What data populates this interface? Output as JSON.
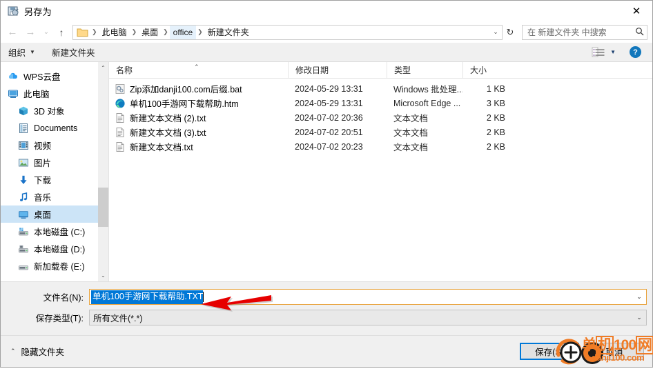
{
  "window": {
    "title": "另存为",
    "title_icon": "save-as-icon",
    "close_label": "✕"
  },
  "address": {
    "back_icon": "←",
    "forward_icon": "→",
    "history_icon": "⌄",
    "up_icon": "↑",
    "folder_icon": "folder-icon",
    "crumbs": [
      {
        "label": "此电脑",
        "highlighted": false
      },
      {
        "label": "桌面",
        "highlighted": false
      },
      {
        "label": "office",
        "highlighted": true
      },
      {
        "label": "新建文件夹",
        "highlighted": false
      }
    ],
    "dropdown_icon": "⌄",
    "refresh_icon": "↻",
    "search_placeholder": "在 新建文件夹 中搜索",
    "search_icon": "search-icon"
  },
  "toolbar": {
    "organize_label": "组织",
    "organize_caret": "▼",
    "new_folder_label": "新建文件夹",
    "view_icon": "view-list-icon",
    "view_caret": "▼",
    "help_label": "?"
  },
  "sidebar": {
    "items": [
      {
        "label": "WPS云盘",
        "icon": "cloud-icon",
        "indent": false,
        "selected": false
      },
      {
        "label": "此电脑",
        "icon": "computer-icon",
        "indent": false,
        "selected": false
      },
      {
        "label": "3D 对象",
        "icon": "3d-object-icon",
        "indent": true,
        "selected": false
      },
      {
        "label": "Documents",
        "icon": "documents-icon",
        "indent": true,
        "selected": false
      },
      {
        "label": "视频",
        "icon": "video-icon",
        "indent": true,
        "selected": false
      },
      {
        "label": "图片",
        "icon": "picture-icon",
        "indent": true,
        "selected": false
      },
      {
        "label": "下载",
        "icon": "download-icon",
        "indent": true,
        "selected": false
      },
      {
        "label": "音乐",
        "icon": "music-icon",
        "indent": true,
        "selected": false
      },
      {
        "label": "桌面",
        "icon": "desktop-icon",
        "indent": true,
        "selected": true
      },
      {
        "label": "本地磁盘 (C:)",
        "icon": "system-drive-icon",
        "indent": true,
        "selected": false
      },
      {
        "label": "本地磁盘 (D:)",
        "icon": "drive-icon",
        "indent": true,
        "selected": false
      },
      {
        "label": "新加载卷 (E:)",
        "icon": "drive-icon",
        "indent": true,
        "selected": false
      }
    ],
    "scroll_up_icon": "⌃",
    "scroll_down_icon": "⌄"
  },
  "filelist": {
    "columns": [
      {
        "label": "名称",
        "key": "name"
      },
      {
        "label": "修改日期",
        "key": "date"
      },
      {
        "label": "类型",
        "key": "type"
      },
      {
        "label": "大小",
        "key": "size"
      }
    ],
    "sort_indicator": "⌃",
    "rows": [
      {
        "name": "Zip添加danji100.com后缀.bat",
        "date": "2024-05-29 13:31",
        "type": "Windows 批处理...",
        "size": "1 KB",
        "icon": "bat-file-icon"
      },
      {
        "name": "单机100手游网下载帮助.htm",
        "date": "2024-05-29 13:31",
        "type": "Microsoft Edge ...",
        "size": "3 KB",
        "icon": "edge-file-icon"
      },
      {
        "name": "新建文本文档 (2).txt",
        "date": "2024-07-02 20:36",
        "type": "文本文档",
        "size": "2 KB",
        "icon": "text-file-icon"
      },
      {
        "name": "新建文本文档 (3).txt",
        "date": "2024-07-02 20:51",
        "type": "文本文档",
        "size": "2 KB",
        "icon": "text-file-icon"
      },
      {
        "name": "新建文本文档.txt",
        "date": "2024-07-02 20:23",
        "type": "文本文档",
        "size": "2 KB",
        "icon": "text-file-icon"
      }
    ]
  },
  "form": {
    "filename_label": "文件名(N):",
    "filename_value": "单机100手游网下载帮助.TXT",
    "filename_dropdown_icon": "⌄",
    "filetype_label": "保存类型(T):",
    "filetype_value": "所有文件(*.*)",
    "filetype_dropdown_icon": "⌄"
  },
  "footer": {
    "hide_folders_label": "隐藏文件夹",
    "hide_folders_caret": "⌃",
    "save_label": "保存(S)",
    "cancel_label": "取消"
  },
  "overlay": {
    "watermark_line1_a": "单",
    "watermark_line1_b": "机",
    "watermark_line1_c": "100",
    "watermark_line1_d": "网",
    "watermark_line2": "danji100.com",
    "watermark_color": "#f07c26",
    "arrow_color": "#e60000",
    "cursor_icon": "click-cursor-icon"
  }
}
